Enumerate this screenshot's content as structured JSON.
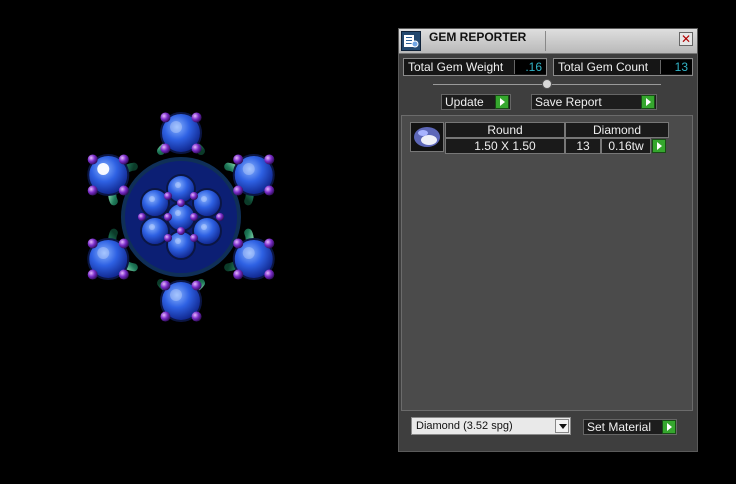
{
  "window": {
    "title": "GEM REPORTER"
  },
  "stats": {
    "weight_label": "Total Gem Weight",
    "weight_value": ".16",
    "count_label": "Total Gem Count",
    "count_value": "13"
  },
  "buttons": {
    "update_label": "Update",
    "save_report_label": "Save Report",
    "set_material_label": "Set Material"
  },
  "table": {
    "headers": {
      "shape": "Round",
      "material": "Diamond"
    },
    "row": {
      "size": "1.50 X 1.50",
      "count": "13",
      "weight": "0.16tw"
    }
  },
  "material_select": {
    "selected": "Diamond     (3.52 spg)"
  },
  "icons": {
    "title": "gem-reporter-icon",
    "close": "close-icon",
    "thumb": "gem-thumbnail-icon",
    "arrow": "play-arrow-icon",
    "dropdown": "chevron-down-icon"
  },
  "colors": {
    "gem_blue": "#1e4fd2",
    "prong_purple": "#7b2cc9",
    "metal_green": "#1f7b5a",
    "value_cyan": "#31b3c6",
    "button_green": "#35a72e"
  }
}
